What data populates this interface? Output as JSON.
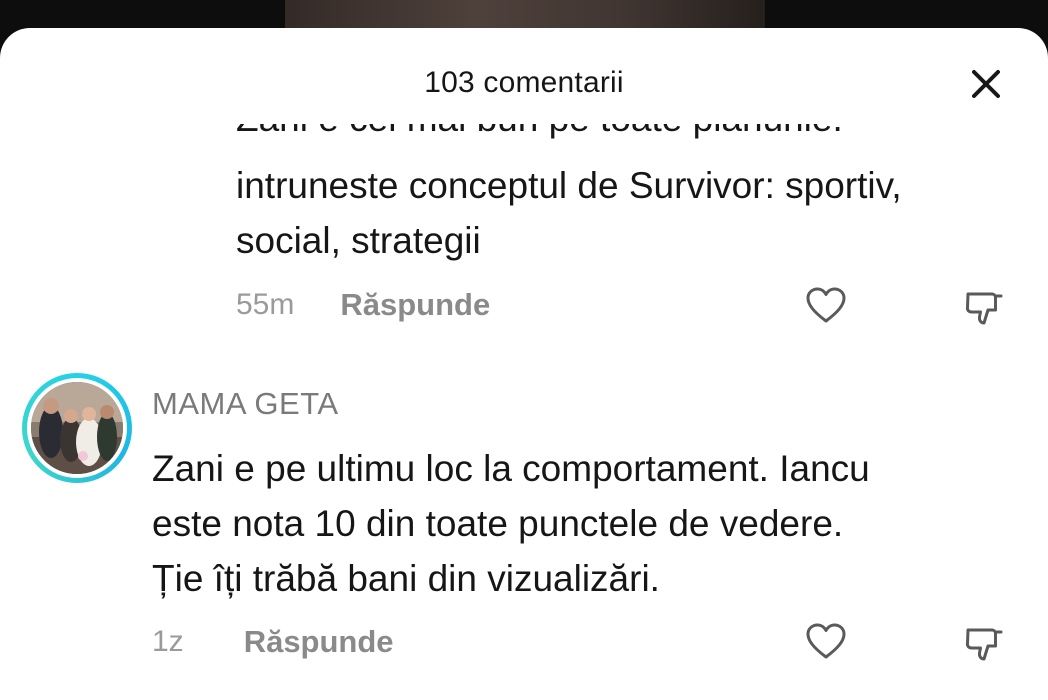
{
  "header": {
    "title": "103 comentarii",
    "close_icon": "close-icon"
  },
  "comments": [
    {
      "cut_line": "Zani e cel mai bun pe toate planurile.",
      "lines": [
        "intruneste conceptul de Survivor: sportiv,",
        "social, strategii"
      ],
      "time": "55m",
      "reply_label": "Răspunde",
      "like_icon": "heart-icon",
      "dislike_icon": "thumbs-down-icon"
    },
    {
      "username": "MAMA GETA",
      "avatar_icon": "avatar",
      "lines": [
        "Zani e pe ultimu loc la comportament. Iancu",
        "este nota 10 din toate punctele de vedere.",
        "Ție îți trăbă bani din vizualizări."
      ],
      "time": "1z",
      "reply_label": "Răspunde",
      "like_icon": "heart-icon",
      "dislike_icon": "thumbs-down-icon"
    }
  ],
  "colors": {
    "avatar_ring": "#24d2e8",
    "text_primary": "#161616",
    "text_secondary": "#8a8a8a"
  }
}
